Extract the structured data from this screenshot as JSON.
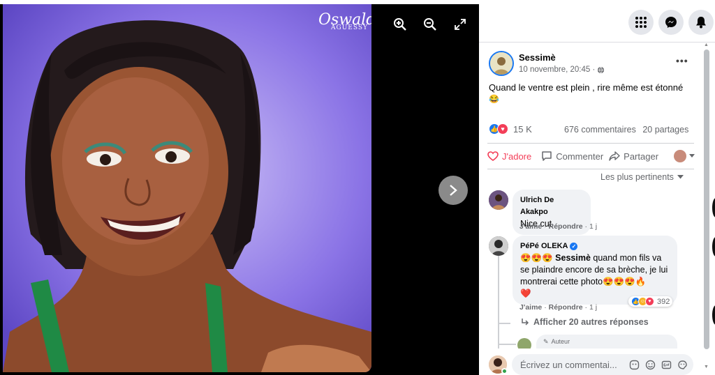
{
  "watermark": {
    "line1": "Oswald",
    "line2": "AGUESSY"
  },
  "viewer": {
    "zoom_in": "zoom-in-icon",
    "zoom_out": "zoom-out-icon",
    "fullscreen": "fullscreen-icon",
    "next": "chevron-right-icon"
  },
  "topbar": {
    "menu": "grid-menu-icon",
    "messenger": "messenger-icon",
    "notifications": "bell-icon"
  },
  "post": {
    "author": "Sessimè",
    "date": "10 novembre, 20:45 ·",
    "privacy": "globe-icon",
    "more": "•••",
    "text": "Quand le ventre est plein , rire même est étonné",
    "emoji": "😂",
    "reaction_count": "15 K",
    "comments_count": "676 commentaires",
    "shares_count": "20 partages",
    "actions": {
      "love": "J'adore",
      "comment": "Commenter",
      "share": "Partager"
    },
    "sort_label": "Les plus pertinents"
  },
  "comments": [
    {
      "name": "Ulrich De Akakpo",
      "text": "Nice cut",
      "like": "J'aime",
      "reply": "Répondre",
      "time": "1 j"
    },
    {
      "name": "PéPé OLEKA",
      "text_prefix": "😍😍😍 ",
      "mention": "Sessimè",
      "text": " quand mon fils va se plaindre encore de sa brèche, je lui montrerai cette photo😍😍😍🔥",
      "text_end": "❤️",
      "like": "J'aime",
      "reply": "Répondre",
      "time": "1 j",
      "reaction_count": "392"
    }
  ],
  "more_replies": "Afficher 20 autres réponses",
  "author_tag": "Auteur",
  "composer": {
    "placeholder": "Écrivez un commentai..."
  },
  "colors": {
    "brand": "#1877f2",
    "love": "#f33e58",
    "muted": "#65676b",
    "bubble": "#f0f2f5"
  }
}
